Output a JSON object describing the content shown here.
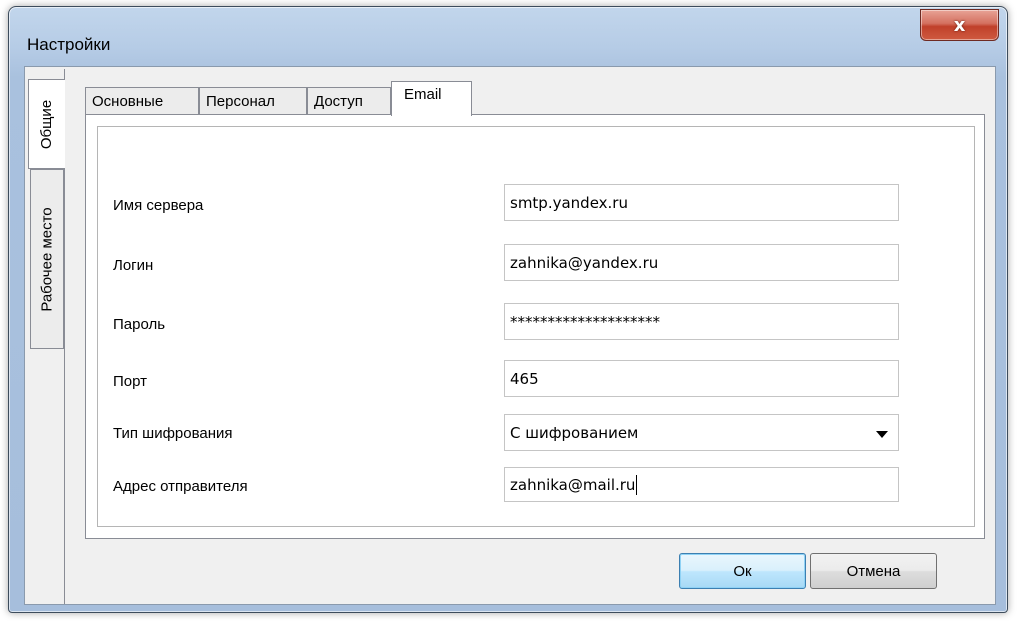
{
  "window": {
    "title": "Настройки",
    "close_glyph": "x"
  },
  "side_tabs": [
    {
      "label": "Общие",
      "active": true
    },
    {
      "label": "Рабочее место",
      "active": false
    }
  ],
  "top_tabs": [
    {
      "label": "Основные",
      "active": false
    },
    {
      "label": "Персонал",
      "active": false
    },
    {
      "label": "Доступ",
      "active": false
    },
    {
      "label": "Email",
      "active": true
    }
  ],
  "form": {
    "server": {
      "label": "Имя сервера",
      "value": "smtp.yandex.ru"
    },
    "login": {
      "label": "Логин",
      "value": "zahnika@yandex.ru"
    },
    "password": {
      "label": "Пароль",
      "value": "********************"
    },
    "port": {
      "label": "Порт",
      "value": "465"
    },
    "encryption": {
      "label": "Тип шифрования",
      "value": "С шифрованием"
    },
    "sender": {
      "label": "Адрес отправителя",
      "value": "zahnika@mail.ru"
    }
  },
  "buttons": {
    "ok": "Ок",
    "cancel": "Отмена"
  },
  "colors": {
    "frame": "#b6cce6",
    "close_button": "#c0402a",
    "ok_button": "#bee6fd"
  }
}
